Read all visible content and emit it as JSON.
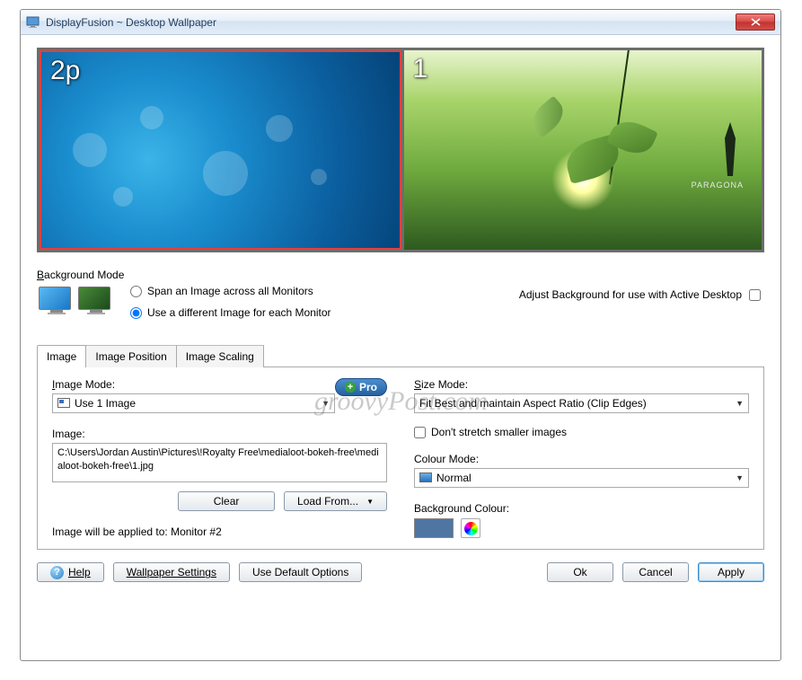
{
  "window": {
    "title": "DisplayFusion ~ Desktop Wallpaper"
  },
  "preview": {
    "monitors": [
      {
        "label": "2p",
        "selected": true
      },
      {
        "label": "1",
        "selected": false,
        "brand": "PARAGONA"
      }
    ]
  },
  "background_mode": {
    "heading_pre": "B",
    "heading_rest": "ackground Mode",
    "radio1": "Span an Image across all Monitors",
    "radio2": "Use a different Image for each Monitor",
    "adjust_label": "Adjust Background for use with Active Desktop"
  },
  "watermark": "groovyPost.com",
  "tabs": {
    "items": [
      "Image",
      "Image Position",
      "Image Scaling"
    ],
    "active_index": 0
  },
  "image_tab": {
    "image_mode_label_pre": "I",
    "image_mode_label_rest": "mage Mode:",
    "image_mode_value": "Use 1 Image",
    "pro_label": "Pro",
    "image_label": "Image:",
    "image_path": "C:\\Users\\Jordan Austin\\Pictures\\!Royalty Free\\medialoot-bokeh-free\\medialoot-bokeh-free\\1.jpg",
    "clear_btn": "Clear",
    "load_from_btn": "Load From...",
    "status_line": "Image will be applied to: Monitor #2",
    "size_mode_label_pre": "S",
    "size_mode_label_rest": "ize Mode:",
    "size_mode_value": "Fit Best and maintain Aspect Ratio (Clip Edges)",
    "dont_stretch": "Don't stretch smaller images",
    "colour_mode_label": "Colour Mode:",
    "colour_mode_value": "Normal",
    "bg_colour_label": "Background Colour:",
    "bg_colour_hex": "#4f76a3"
  },
  "bottom": {
    "help": "Help",
    "wallpaper_settings": "Wallpaper Settings",
    "use_defaults": "Use Default Options",
    "ok": "Ok",
    "cancel": "Cancel",
    "apply": "Apply"
  }
}
